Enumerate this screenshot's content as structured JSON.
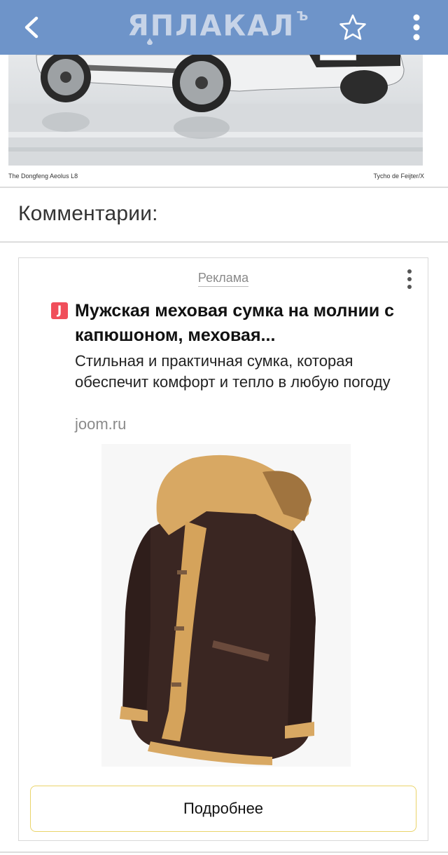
{
  "header": {
    "logo_text": "ЯПЛАКАЛ",
    "logo_suffix": "Ъ",
    "back_icon": "chevron-left-icon",
    "star_icon": "star-outline-icon",
    "menu_icon": "kebab-vertical-icon",
    "background": "#6e94c9"
  },
  "photo": {
    "caption_left": "The Dongfeng Aeolus L8",
    "caption_right": "Tycho de Feijter/X"
  },
  "comments": {
    "title": "Комментарии:"
  },
  "ad": {
    "label": "Реклама",
    "brand_mark": "J",
    "title": "Мужская меховая сумка на молнии с капюшоном, меховая...",
    "description": "Стильная и практичная сумка, которая обеспечит комфорт и тепло в любую погоду",
    "domain": "joom.ru",
    "button_label": "Подробнее",
    "brand_color": "#f04e5a",
    "button_border_color": "#ead46a"
  }
}
